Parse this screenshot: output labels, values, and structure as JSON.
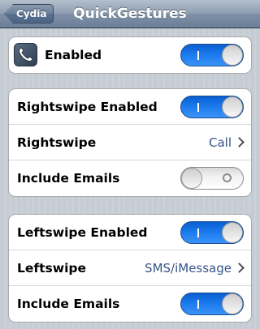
{
  "navbar": {
    "back_label": "Cydia",
    "title": "QuickGestures"
  },
  "groups": [
    {
      "rows": [
        {
          "label": "Enabled",
          "icon": "phone-handset-icon",
          "switch": true
        }
      ]
    },
    {
      "rows": [
        {
          "label": "Rightswipe Enabled",
          "switch": true
        },
        {
          "label": "Rightswipe",
          "value": "Call"
        },
        {
          "label": "Include Emails",
          "switch": false
        }
      ]
    },
    {
      "rows": [
        {
          "label": "Leftswipe Enabled",
          "switch": true
        },
        {
          "label": "Leftswipe",
          "value": "SMS/iMessage"
        },
        {
          "label": "Include Emails",
          "switch": true
        }
      ]
    }
  ],
  "colors": {
    "switch_on": "#1c7bef",
    "value_text": "#385487",
    "background": "#c5ccd4"
  }
}
